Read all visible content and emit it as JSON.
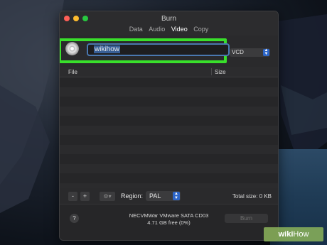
{
  "window": {
    "title": "Burn",
    "tabs": [
      "Data",
      "Audio",
      "Video",
      "Copy"
    ],
    "active_tab": "Video"
  },
  "disc": {
    "name_value": "wikihow",
    "format": "VCD"
  },
  "table": {
    "col_file": "File",
    "col_size": "Size"
  },
  "bottom": {
    "remove_label": "-",
    "add_label": "+",
    "gear_label": "⚙▾",
    "region_label": "Region:",
    "region_value": "PAL",
    "total_size": "Total size: 0 KB"
  },
  "footer": {
    "help_label": "?",
    "device": "NECVMWar VMware SATA CD03",
    "free_space": "4.71 GB free (0%)",
    "burn_label": "Burn"
  },
  "watermark": {
    "wiki": "wiki",
    "how": "How"
  },
  "colors": {
    "highlight_frame": "#39e02b",
    "accent": "#2d66c8"
  }
}
